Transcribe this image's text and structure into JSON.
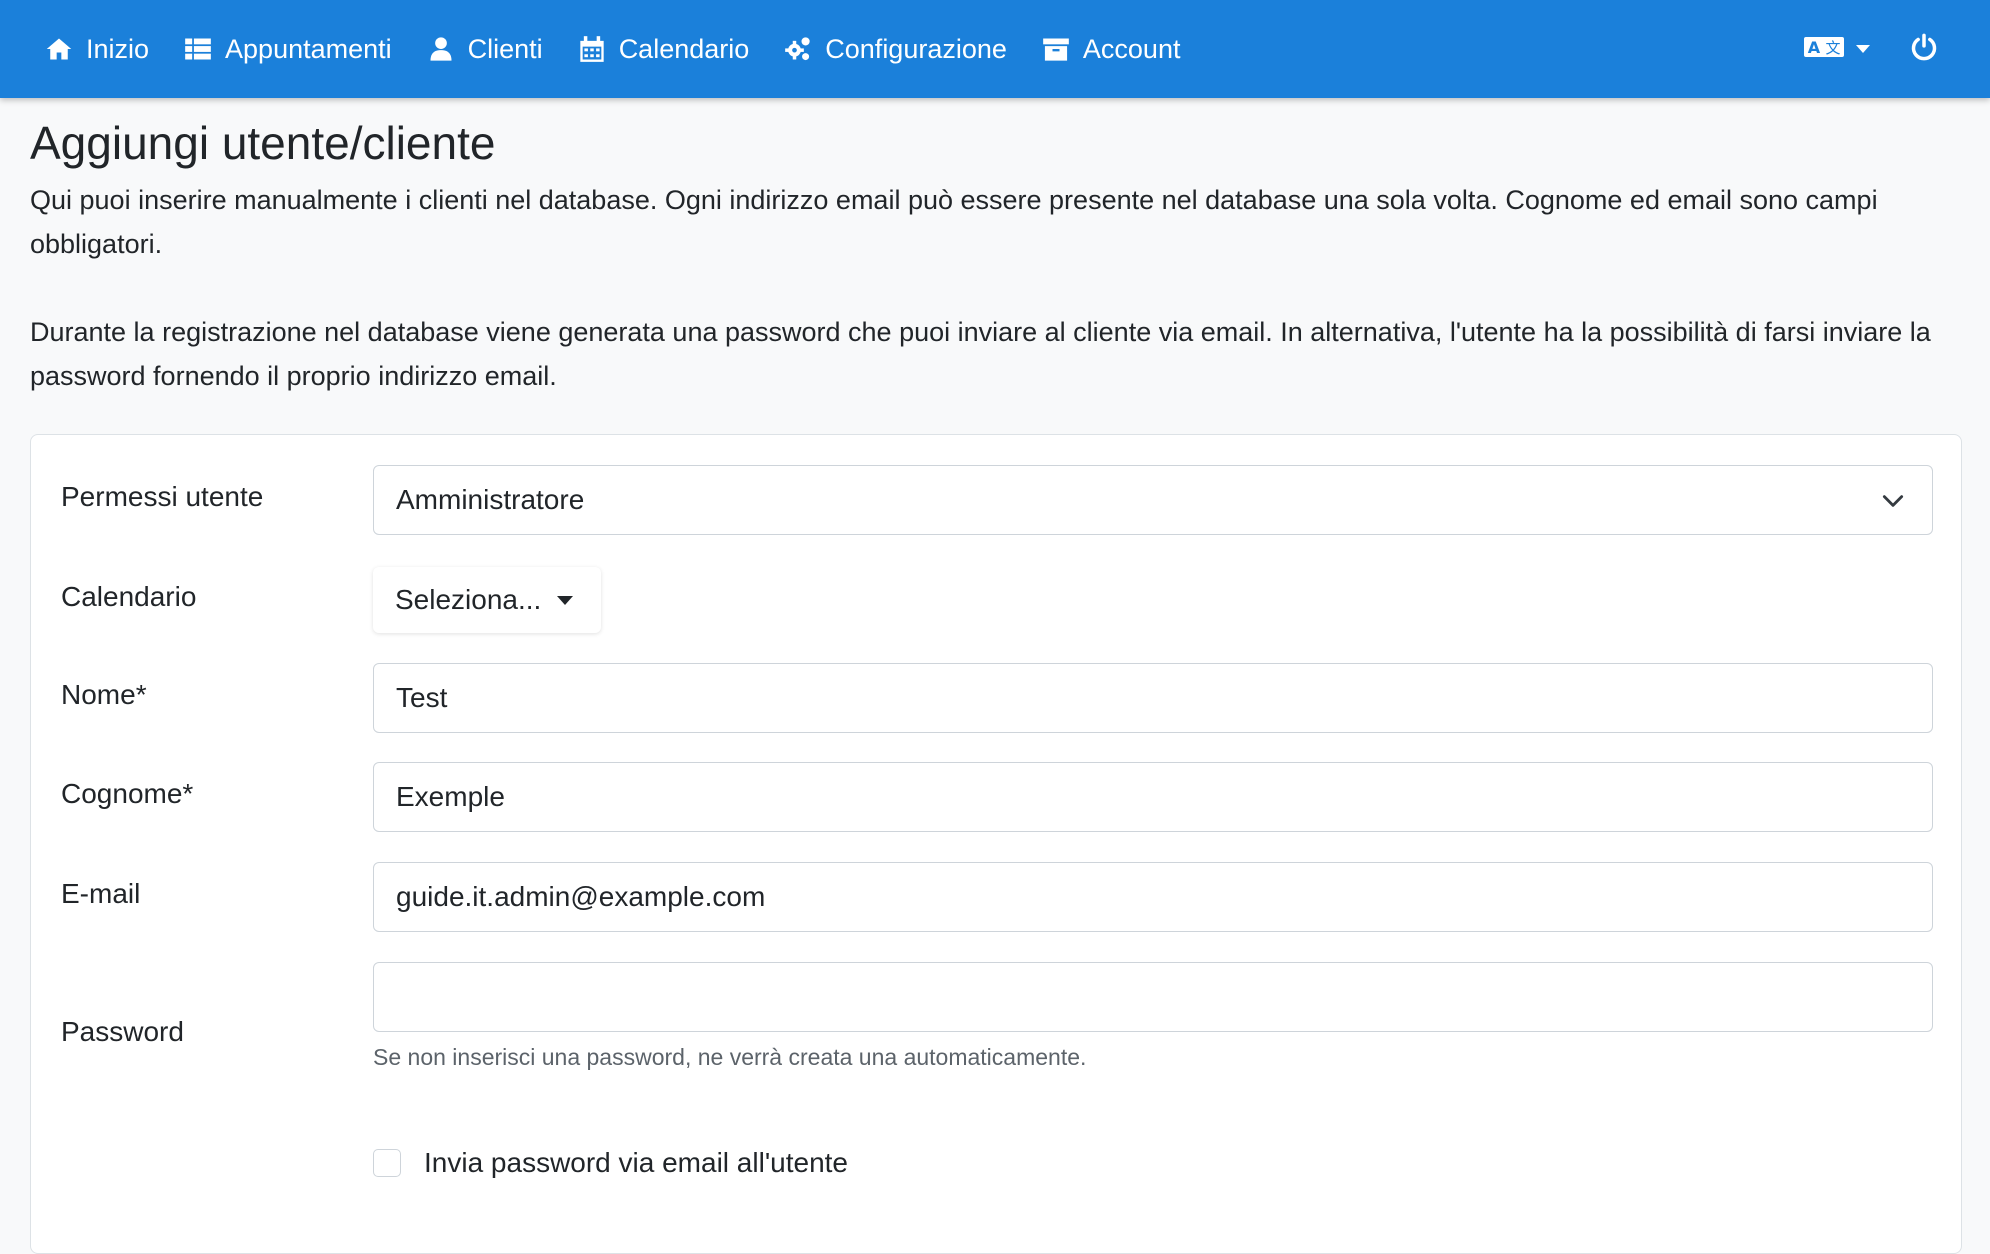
{
  "nav": {
    "items": [
      {
        "label": "Inizio",
        "icon": "home-icon"
      },
      {
        "label": "Appuntamenti",
        "icon": "list-icon"
      },
      {
        "label": "Clienti",
        "icon": "user-icon"
      },
      {
        "label": "Calendario",
        "icon": "calendar-icon"
      },
      {
        "label": "Configurazione",
        "icon": "gears-icon"
      },
      {
        "label": "Account",
        "icon": "archive-icon"
      }
    ],
    "right": {
      "language_icon": "language-icon",
      "power_icon": "power-icon"
    },
    "bg_color": "#1b80da"
  },
  "page": {
    "title": "Aggiungi utente/cliente",
    "intro_1": "Qui puoi inserire manualmente i clienti nel database. Ogni indirizzo email può essere presente nel database una sola volta. Cognome ed email sono campi obbligatori.",
    "intro_2": "Durante la registrazione nel database viene generata una password che puoi inviare al cliente via email. In alternativa, l'utente ha la possibilità di farsi inviare la password fornendo il proprio indirizzo email."
  },
  "form": {
    "permissions": {
      "label": "Permessi utente",
      "value": "Amministratore"
    },
    "calendar": {
      "label": "Calendario",
      "value": "Seleziona..."
    },
    "first_name": {
      "label": "Nome*",
      "value": "Test"
    },
    "last_name": {
      "label": "Cognome*",
      "value": "Exemple"
    },
    "email": {
      "label": "E-mail",
      "value": "guide.it.admin@example.com"
    },
    "password": {
      "label": "Password",
      "value": "",
      "help": "Se non inserisci una password, ne verrà creata una automaticamente."
    },
    "send_password": {
      "label": "Invia password via email all'utente",
      "checked": false
    }
  }
}
